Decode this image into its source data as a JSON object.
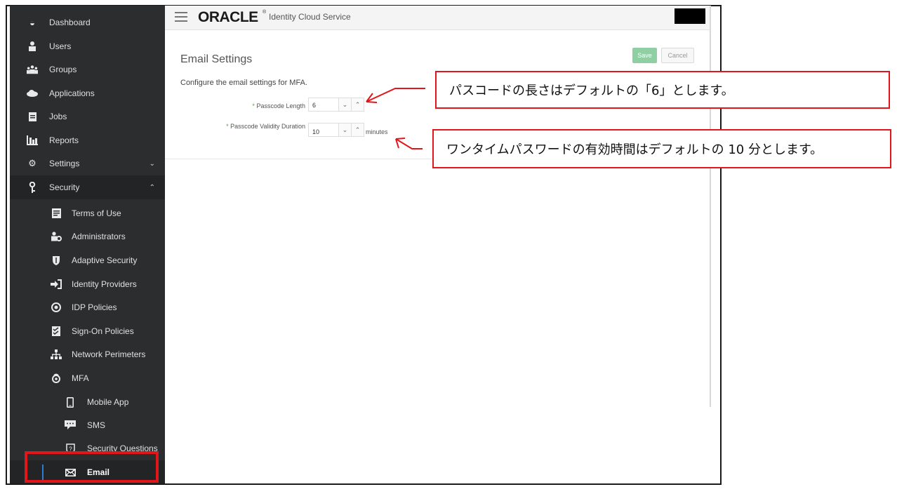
{
  "app": {
    "brand": "ORACLE",
    "trademark": "®",
    "service": "Identity Cloud Service"
  },
  "sidebar": {
    "items": [
      {
        "label": "Dashboard",
        "icon": "dashboard-icon"
      },
      {
        "label": "Users",
        "icon": "user-icon"
      },
      {
        "label": "Groups",
        "icon": "groups-icon"
      },
      {
        "label": "Applications",
        "icon": "cloud-icon"
      },
      {
        "label": "Jobs",
        "icon": "clipboard-icon"
      },
      {
        "label": "Reports",
        "icon": "bar-chart-icon"
      },
      {
        "label": "Settings",
        "icon": "gear-icon"
      },
      {
        "label": "Security",
        "icon": "key-icon"
      }
    ],
    "security_items": [
      {
        "label": "Terms of Use",
        "icon": "document-icon"
      },
      {
        "label": "Administrators",
        "icon": "admin-user-icon"
      },
      {
        "label": "Adaptive Security",
        "icon": "shield-icon"
      },
      {
        "label": "Identity Providers",
        "icon": "sign-in-icon"
      },
      {
        "label": "IDP Policies",
        "icon": "policy-icon"
      },
      {
        "label": "Sign-On Policies",
        "icon": "checklist-icon"
      },
      {
        "label": "Network Perimeters",
        "icon": "network-icon"
      },
      {
        "label": "MFA",
        "icon": "mfa-icon"
      }
    ],
    "mfa_items": [
      {
        "label": "Mobile App",
        "icon": "mobile-icon"
      },
      {
        "label": "SMS",
        "icon": "chat-icon"
      },
      {
        "label": "Security Questions",
        "icon": "question-shield-icon"
      },
      {
        "label": "Email",
        "icon": "envelope-icon"
      }
    ]
  },
  "main": {
    "title": "Email Settings",
    "description": "Configure the email settings for MFA.",
    "save_label": "Save",
    "cancel_label": "Cancel",
    "passcode_length": {
      "label": "Passcode Length",
      "value": "6"
    },
    "passcode_validity": {
      "label": "Passcode Validity Duration",
      "value": "10",
      "units": "minutes"
    }
  },
  "annotations": {
    "callout_1": "パスコードの長さはデフォルトの「6」とします。",
    "callout_2": "ワンタイムパスワードの有効時間はデフォルトの 10 分とします。"
  },
  "colors": {
    "sidebar_bg": "#2b2d2f",
    "save_button": "#8fcfa3",
    "highlight_red": "#e0161b",
    "active_indicator": "#2d7dd2"
  }
}
